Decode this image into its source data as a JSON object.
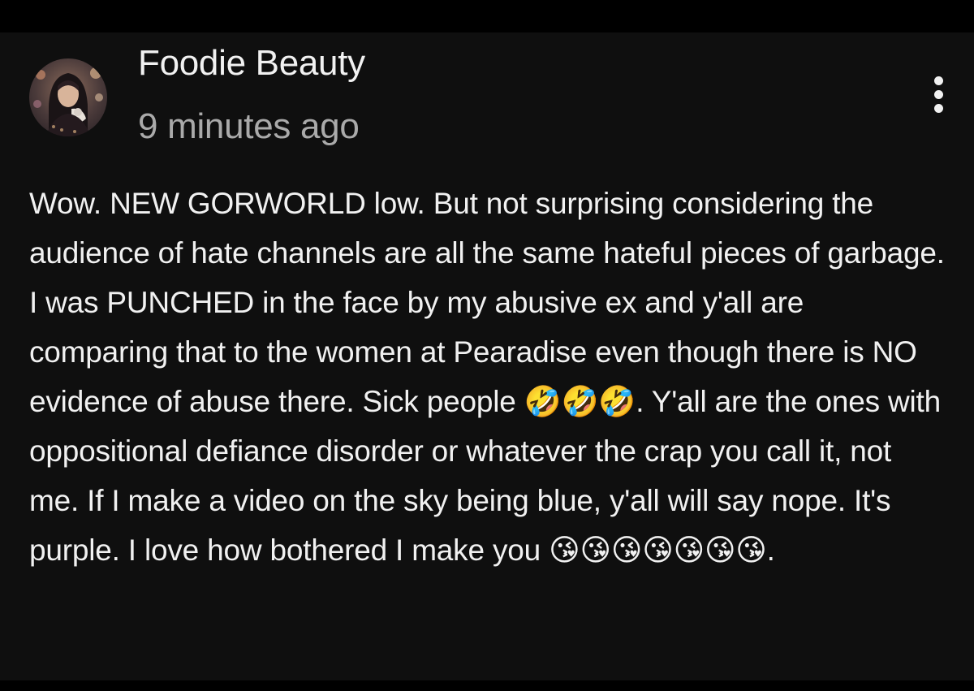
{
  "comment": {
    "author": "Foodie Beauty",
    "timestamp": "9 minutes ago",
    "menu_icon": "more-vertical-icon",
    "avatar_icon": "profile-photo",
    "body": "Wow. NEW GORWORLD low. But not surprising considering the audience of hate channels are all the same hateful pieces of garbage. I was PUNCHED in the face by my abusive ex and y'all are comparing that to the women at Pearadise even though there is NO evidence of abuse there. Sick people 🤣🤣🤣. Y'all are the ones with oppositional defiance disorder or whatever the crap you call it, not me. If I make a video on the sky being blue, y'all will say nope. It's purple. I love how bothered I make you 😘😘😘😘😘😘😘."
  },
  "colors": {
    "background": "#0f0f0f",
    "primary_text": "#f1f1f1",
    "secondary_text": "#aaaaaa"
  }
}
